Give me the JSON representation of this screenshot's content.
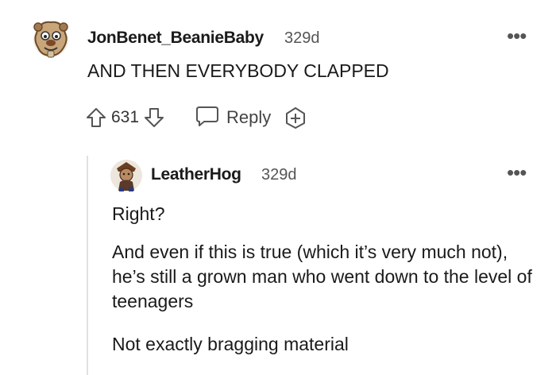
{
  "comment": {
    "username": "JonBenet_BeanieBaby",
    "age": "329d",
    "more_icon": "more-horizontal-icon",
    "body": "AND THEN EVERYBODY CLAPPED",
    "score": "631",
    "reply_label": "Reply",
    "icons": {
      "upvote": "upvote-arrow-icon",
      "downvote": "downvote-arrow-icon",
      "reply": "speech-bubble-icon",
      "award": "award-plus-icon"
    }
  },
  "reply": {
    "username": "LeatherHog",
    "age": "329d",
    "more_icon": "more-horizontal-icon",
    "paragraphs": [
      "Right?",
      "And even if this is true (which it’s very much not), he’s still a grown man who went down to the level of teenagers",
      "Not exactly bragging material"
    ]
  },
  "colors": {
    "text": "#1a1a1b",
    "meta": "#555555",
    "thread_line": "#e1e1e1",
    "icon": "#555555"
  }
}
